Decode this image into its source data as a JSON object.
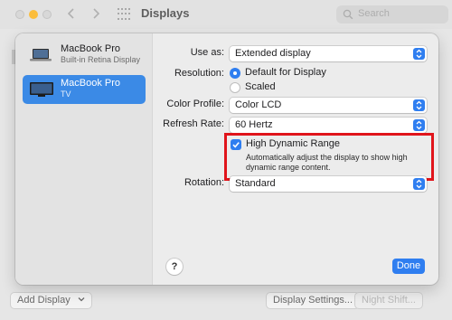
{
  "window": {
    "title": "Displays",
    "search_placeholder": "Search",
    "back_icon": "chevron-left-icon",
    "forward_icon": "chevron-right-icon",
    "grid_icon": "show-all-grid-icon"
  },
  "footer": {
    "add_display": "Add Display",
    "display_settings": "Display Settings...",
    "night_shift": "Night Shift..."
  },
  "sidebar": {
    "items": [
      {
        "name": "MacBook Pro",
        "subtitle": "Built-in Retina Display",
        "icon": "laptop-icon",
        "selected": false
      },
      {
        "name": "MacBook Pro",
        "subtitle": "TV",
        "icon": "tv-icon",
        "selected": true
      }
    ]
  },
  "settings": {
    "use_as": {
      "label": "Use as:",
      "value": "Extended display"
    },
    "resolution": {
      "label": "Resolution:",
      "options": [
        "Default for Display",
        "Scaled"
      ],
      "selected": "Default for Display"
    },
    "color_profile": {
      "label": "Color Profile:",
      "value": "Color LCD"
    },
    "refresh_rate": {
      "label": "Refresh Rate:",
      "value": "60 Hertz"
    },
    "hdr": {
      "label": "High Dynamic Range",
      "description": "Automatically adjust the display to show high dynamic range content.",
      "checked": true
    },
    "rotation": {
      "label": "Rotation:",
      "value": "Standard"
    }
  },
  "buttons": {
    "help": "?",
    "done": "Done"
  },
  "colors": {
    "accent": "#2f7ef0",
    "selection": "#3b8ae6",
    "highlight_box": "#e0141b"
  }
}
